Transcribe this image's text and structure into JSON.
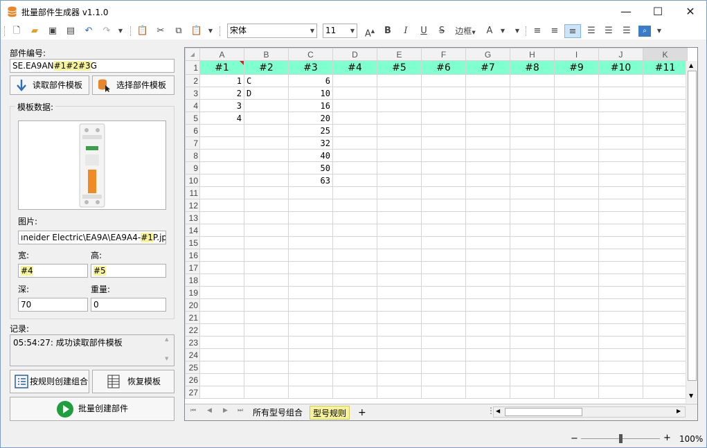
{
  "app": {
    "title": "批量部件生成器 v1.1.0"
  },
  "window": {
    "minimize": "—",
    "maximize": "☐",
    "close": "✕"
  },
  "toolbar": {
    "font_name": "宋体",
    "font_size": "11",
    "border_label": "边框",
    "bold": "B",
    "italic": "I",
    "underline": "U",
    "strike": "S",
    "grow_font": "A",
    "font_color": "A"
  },
  "left": {
    "part_no_label": "部件编号:",
    "part_no_value_prefix": "SE.EA9AN",
    "part_no_value_hl": "#1#2#3",
    "part_no_value_suffix": "G",
    "read_template_btn": "读取部件模板",
    "select_template_btn": "选择部件模板",
    "template_data_label": "模板数据:",
    "image_label": "图片:",
    "image_path_prefix": "ıneider Electric\\EA9A\\EA9A4-",
    "image_path_hl": "#1",
    "image_path_suffix": "P.jpg",
    "width_label": "宽:",
    "width_value": "#4",
    "height_label": "高:",
    "height_value": "#5",
    "depth_label": "深:",
    "depth_value": "70",
    "weight_label": "重量:",
    "weight_value": "0",
    "log_label": "记录:",
    "log_text": "05:54:27: 成功读取部件模板",
    "rule_combo_btn": "按规则创建组合",
    "restore_btn": "恢复模板",
    "batch_create_btn": "批量创建部件"
  },
  "sheet": {
    "columns": [
      "A",
      "B",
      "C",
      "D",
      "E",
      "F",
      "G",
      "H",
      "I",
      "J",
      "K"
    ],
    "header_row": [
      "#1",
      "#2",
      "#3",
      "#4",
      "#5",
      "#6",
      "#7",
      "#8",
      "#9",
      "#10",
      "#11"
    ],
    "rows": [
      [
        "1",
        "C",
        "6"
      ],
      [
        "2",
        "D",
        "10"
      ],
      [
        "3",
        "",
        "16"
      ],
      [
        "4",
        "",
        "20"
      ],
      [
        "",
        "",
        "25"
      ],
      [
        "",
        "",
        "32"
      ],
      [
        "",
        "",
        "40"
      ],
      [
        "",
        "",
        "50"
      ],
      [
        "",
        "",
        "63"
      ]
    ],
    "row_numbers": [
      "1",
      "2",
      "3",
      "4",
      "5",
      "6",
      "7",
      "8",
      "9",
      "10",
      "11",
      "12",
      "13",
      "14",
      "15",
      "16",
      "17",
      "18",
      "19",
      "20",
      "21",
      "22",
      "23",
      "24",
      "25",
      "26",
      "27"
    ]
  },
  "tabs": {
    "tab1": "所有型号组合",
    "tab2": "型号规则",
    "add": "+"
  },
  "status": {
    "zoom": "100%",
    "minus": "−",
    "plus": "+"
  },
  "colors": {
    "header_fill": "#80ffd0",
    "highlight": "#f7f39a",
    "play_green": "#1e9e3c"
  }
}
